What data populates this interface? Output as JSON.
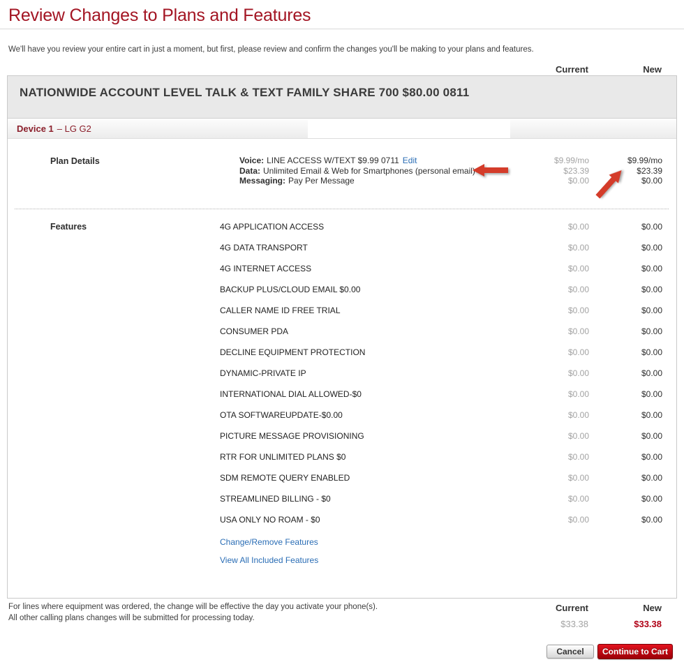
{
  "colors": {
    "accent_red": "#a31523",
    "arrow_red": "#d43c2a",
    "link_blue": "#2a6db5",
    "new_total_red": "#b00016",
    "button_red": "#c3000d"
  },
  "page": {
    "title": "Review Changes to Plans and Features",
    "intro": "We'll have you review your entire cart in just a moment, but first, please review and confirm the changes you'll be making to your plans and features."
  },
  "columns": {
    "current": "Current",
    "new": "New"
  },
  "plan": {
    "name": "NATIONWIDE ACCOUNT LEVEL TALK & TEXT FAMILY SHARE 700 $80.00 0811"
  },
  "device": {
    "label": "Device 1",
    "name": "– LG G2"
  },
  "plan_details": {
    "label": "Plan Details",
    "rows": [
      {
        "label": "Voice:",
        "text": "LINE ACCESS W/TEXT $9.99 0711",
        "link": "Edit",
        "current": "$9.99/mo",
        "new": "$9.99/mo"
      },
      {
        "label": "Data:",
        "text": "Unlimited Email & Web for Smartphones (personal email)",
        "current": "$23.39",
        "new": "$23.39"
      },
      {
        "label": "Messaging:",
        "text": "Pay Per Message",
        "current": "$0.00",
        "new": "$0.00"
      }
    ]
  },
  "features": {
    "label": "Features",
    "items": [
      {
        "name": "4G APPLICATION ACCESS",
        "current": "$0.00",
        "new": "$0.00"
      },
      {
        "name": "4G DATA TRANSPORT",
        "current": "$0.00",
        "new": "$0.00"
      },
      {
        "name": "4G INTERNET ACCESS",
        "current": "$0.00",
        "new": "$0.00"
      },
      {
        "name": "BACKUP PLUS/CLOUD EMAIL $0.00",
        "current": "$0.00",
        "new": "$0.00"
      },
      {
        "name": "CALLER NAME ID FREE TRIAL",
        "current": "$0.00",
        "new": "$0.00"
      },
      {
        "name": "CONSUMER PDA",
        "current": "$0.00",
        "new": "$0.00"
      },
      {
        "name": "DECLINE EQUIPMENT PROTECTION",
        "current": "$0.00",
        "new": "$0.00"
      },
      {
        "name": "DYNAMIC-PRIVATE IP",
        "current": "$0.00",
        "new": "$0.00"
      },
      {
        "name": "INTERNATIONAL DIAL ALLOWED-$0",
        "current": "$0.00",
        "new": "$0.00"
      },
      {
        "name": "OTA SOFTWAREUPDATE-$0.00",
        "current": "$0.00",
        "new": "$0.00"
      },
      {
        "name": "PICTURE MESSAGE PROVISIONING",
        "current": "$0.00",
        "new": "$0.00"
      },
      {
        "name": "RTR FOR UNLIMITED PLANS $0",
        "current": "$0.00",
        "new": "$0.00"
      },
      {
        "name": "SDM REMOTE QUERY ENABLED",
        "current": "$0.00",
        "new": "$0.00"
      },
      {
        "name": "STREAMLINED BILLING - $0",
        "current": "$0.00",
        "new": "$0.00"
      },
      {
        "name": "USA ONLY NO ROAM - $0",
        "current": "$0.00",
        "new": "$0.00"
      }
    ],
    "change_link": "Change/Remove Features",
    "view_link": "View All Included Features"
  },
  "footer": {
    "line1": "For lines where equipment was ordered, the change will be effective the day you activate your phone(s).",
    "line2": "All other calling plans changes will be submitted for processing today.",
    "current_label": "Current",
    "new_label": "New",
    "current_total": "$33.38",
    "new_total": "$33.38",
    "cancel": "Cancel",
    "continue": "Continue to Cart"
  }
}
